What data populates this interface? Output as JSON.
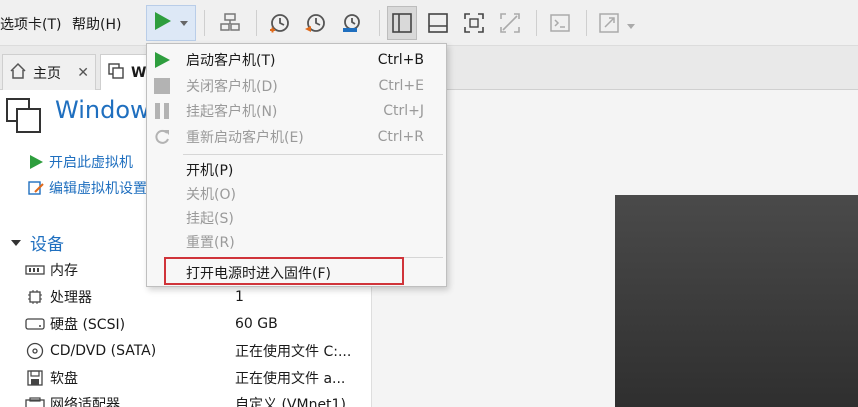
{
  "menu": {
    "tabs_menu": "选项卡(T)",
    "help_menu": "帮助(H)"
  },
  "tabs": [
    {
      "label": "主页"
    },
    {
      "label": "W"
    }
  ],
  "vm": {
    "title": "Window"
  },
  "actions": {
    "power_on": "开启此虚拟机",
    "edit_settings": "编辑虚拟机设置"
  },
  "devices_section": "设备",
  "devices": [
    {
      "name": "内存",
      "value": ""
    },
    {
      "name": "处理器",
      "value": "1"
    },
    {
      "name": "硬盘 (SCSI)",
      "value": "60 GB"
    },
    {
      "name": "CD/DVD (SATA)",
      "value": "正在使用文件 C:..."
    },
    {
      "name": "软盘",
      "value": "正在使用文件 a..."
    },
    {
      "name": "网络适配器",
      "value": "自定义 (VMnet1)"
    }
  ],
  "dropdown": {
    "items": [
      {
        "label": "启动客户机(T)",
        "shortcut": "Ctrl+B"
      },
      {
        "label": "关闭客户机(D)",
        "shortcut": "Ctrl+E"
      },
      {
        "label": "挂起客户机(N)",
        "shortcut": "Ctrl+J"
      },
      {
        "label": "重新启动客户机(E)",
        "shortcut": "Ctrl+R"
      },
      {
        "label": "开机(P)"
      },
      {
        "label": "关机(O)"
      },
      {
        "label": "挂起(S)"
      },
      {
        "label": "重置(R)"
      },
      {
        "label": "打开电源时进入固件(F)"
      }
    ]
  },
  "colors": {
    "accent": "#1f6fbf",
    "play_green": "#2e9e3e",
    "highlight_red": "#d0343a",
    "orange": "#e06a1b"
  }
}
